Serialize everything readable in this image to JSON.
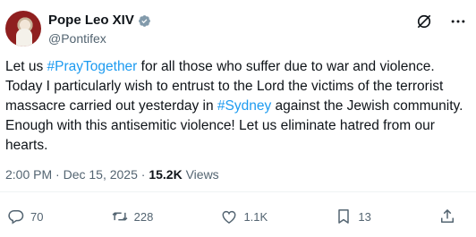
{
  "author": {
    "display_name": "Pope Leo XIV",
    "handle": "@Pontifex",
    "verified": true
  },
  "tweet": {
    "seg1": "Let us ",
    "hashtag1": "#PrayTogether",
    "seg2": " for all those who suffer due to war and violence. Today I particularly wish to entrust to the Lord the victims of the terrorist massacre carried out yesterday in ",
    "hashtag2": "#Sydney",
    "seg3": " against the Jewish community. Enough with this antisemitic violence! Let us eliminate hatred from our hearts."
  },
  "meta": {
    "time": "2:00 PM",
    "sep1": " · ",
    "date": "Dec 15, 2025",
    "sep2": " · ",
    "views_count": "15.2K",
    "views_label": " Views"
  },
  "actions": {
    "replies": "70",
    "reposts": "228",
    "likes": "1.1K",
    "bookmarks": "13"
  },
  "colors": {
    "accent": "#1d9bf0",
    "text": "#0f1419",
    "muted": "#536471"
  },
  "icons": [
    "verified-badge-icon",
    "grok-icon",
    "more-icon",
    "reply-icon",
    "repost-icon",
    "like-icon",
    "bookmark-icon",
    "share-icon"
  ]
}
